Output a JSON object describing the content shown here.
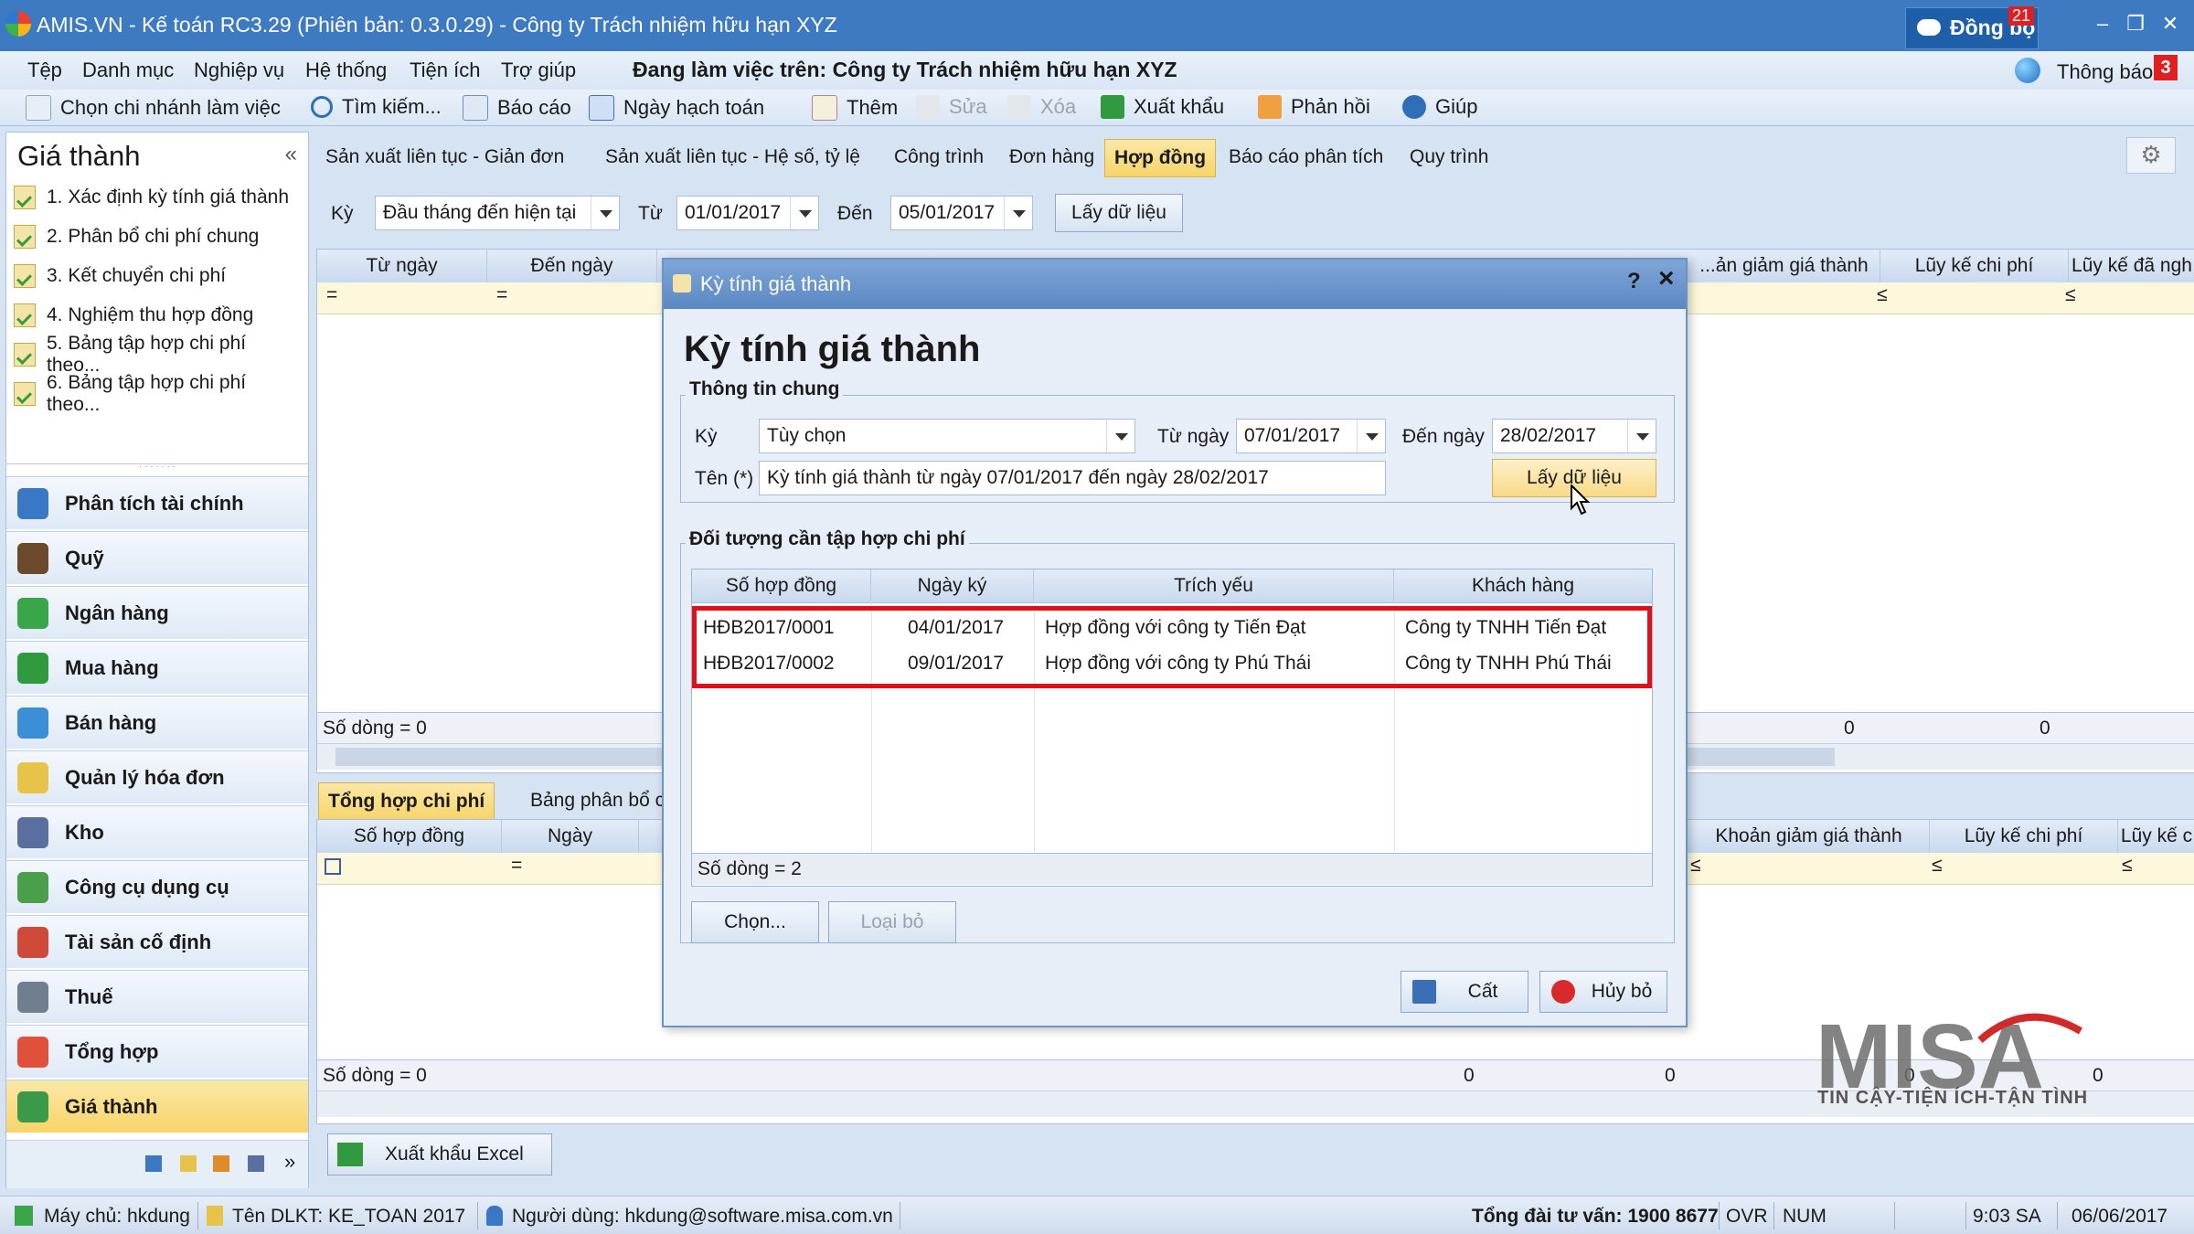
{
  "window": {
    "title": "AMIS.VN - Kế toán RC3.29 (Phiên bản: 0.3.0.29) - Công ty Trách nhiệm hữu hạn XYZ",
    "sync_label": "Đồng bộ",
    "sync_count": "21"
  },
  "menu": {
    "items": [
      "Tệp",
      "Danh mục",
      "Nghiệp vụ",
      "Hệ thống",
      "Tiện ích",
      "Trợ giúp"
    ],
    "working_on": "Đang làm việc trên:  Công ty Trách nhiệm hữu hạn XYZ",
    "notification_label": "Thông báo",
    "notification_count": "3"
  },
  "toolbar": {
    "branch": "Chọn chi nhánh làm việc",
    "search": "Tìm kiếm...",
    "report": "Báo cáo",
    "posting_date": "Ngày hạch toán",
    "add": "Thêm",
    "edit": "Sửa",
    "delete": "Xóa",
    "export": "Xuất khẩu",
    "feedback": "Phản hồi",
    "help": "Giúp"
  },
  "left_panel": {
    "title": "Giá thành",
    "tasks": [
      "1. Xác định kỳ tính giá thành",
      "2. Phân bổ chi phí chung",
      "3. Kết chuyển chi phí",
      "4. Nghiệm thu hợp đồng",
      "5. Bảng tập hợp chi phí theo...",
      "6. Bảng tập hợp chi phí theo..."
    ],
    "modules": [
      {
        "label": "Phân tích tài chính",
        "color": "#3a78c5"
      },
      {
        "label": "Quỹ",
        "color": "#6b4a2b"
      },
      {
        "label": "Ngân hàng",
        "color": "#3aa64a"
      },
      {
        "label": "Mua hàng",
        "color": "#2f9a3e"
      },
      {
        "label": "Bán hàng",
        "color": "#3a8fd6"
      },
      {
        "label": "Quản lý hóa đơn",
        "color": "#e8c34a"
      },
      {
        "label": "Kho",
        "color": "#5a6fa0"
      },
      {
        "label": "Công cụ dụng cụ",
        "color": "#4aa04a"
      },
      {
        "label": "Tài sản cố định",
        "color": "#d04a3a"
      },
      {
        "label": "Thuế",
        "color": "#6f7f8f"
      },
      {
        "label": "Tổng hợp",
        "color": "#e0503a"
      },
      {
        "label": "Giá thành",
        "color": "#3a9a4a"
      }
    ]
  },
  "tabs": [
    "Sản xuất liên tục - Giản đơn",
    "Sản xuất liên tục - Hệ số, tỷ lệ",
    "Công trình",
    "Đơn hàng",
    "Hợp đồng",
    "Báo cáo phân tích",
    "Quy trình"
  ],
  "active_tab": "Hợp đồng",
  "filter": {
    "period_label": "Kỳ",
    "period_value": "Đầu tháng đến hiện tại",
    "from_label": "Từ",
    "from_value": "01/01/2017",
    "to_label": "Đến",
    "to_value": "05/01/2017",
    "fetch": "Lấy dữ liệu"
  },
  "top_grid": {
    "columns_left": [
      "Từ ngày",
      "Đến ngày"
    ],
    "columns_right": [
      "...ản giảm giá thành",
      "Lũy kế chi phí",
      "Lũy kế đã ngh"
    ],
    "row_count": "Số dòng = 0",
    "totals": [
      "0",
      "0"
    ]
  },
  "bottom_tabs": [
    "Tổng hợp chi phí",
    "Bảng phân bổ c"
  ],
  "bottom_grid": {
    "columns_left": [
      "Số hợp đồng",
      "Ngày"
    ],
    "columns_right": [
      "Khoản giảm giá thành",
      "Lũy kế chi phí",
      "Lũy kế c"
    ],
    "row_count": "Số dòng = 0",
    "totals": [
      "0",
      "0",
      "0",
      "0"
    ]
  },
  "export_excel": "Xuất khẩu Excel",
  "dialog": {
    "title": "Kỳ tính giá thành",
    "heading": "Kỳ tính giá thành",
    "general_group": "Thông tin chung",
    "period_label": "Kỳ",
    "period_value": "Tùy chọn",
    "from_label": "Từ ngày",
    "from_value": "07/01/2017",
    "to_label": "Đến ngày",
    "to_value": "28/02/2017",
    "name_label": "Tên (*)",
    "name_value": "Kỳ tính giá thành từ ngày 07/01/2017 đến ngày 28/02/2017",
    "fetch": "Lấy dữ liệu",
    "objects_group": "Đối tượng cần tập hợp chi phí",
    "columns": [
      "Số hợp đồng",
      "Ngày ký",
      "Trích yếu",
      "Khách hàng"
    ],
    "rows": [
      {
        "contract": "HĐB2017/0001",
        "date": "04/01/2017",
        "summary": "Hợp đồng với công ty Tiến Đạt",
        "customer": "Công ty TNHH Tiến Đạt"
      },
      {
        "contract": "HĐB2017/0002",
        "date": "09/01/2017",
        "summary": "Hợp đồng với công ty Phú Thái",
        "customer": "Công ty TNHH Phú Thái"
      }
    ],
    "row_count": "Số dòng = 2",
    "choose": "Chọn...",
    "remove": "Loại bỏ",
    "save": "Cất",
    "cancel": "Hủy bỏ",
    "help": "?",
    "close": "×"
  },
  "statusbar": {
    "server": "Máy chủ: hkdung",
    "db": "Tên DLKT: KE_TOAN 2017",
    "user": "Người dùng: hkdung@software.misa.com.vn",
    "hotline": "Tổng đài tư vấn: 1900 8677",
    "ovr": "OVR",
    "num": "NUM",
    "time": "9:03 SA",
    "date": "06/06/2017"
  },
  "watermark": {
    "logo": "MISA",
    "tagline": "TIN CẬY-TIỆN ÍCH-TẬN TÌNH"
  }
}
